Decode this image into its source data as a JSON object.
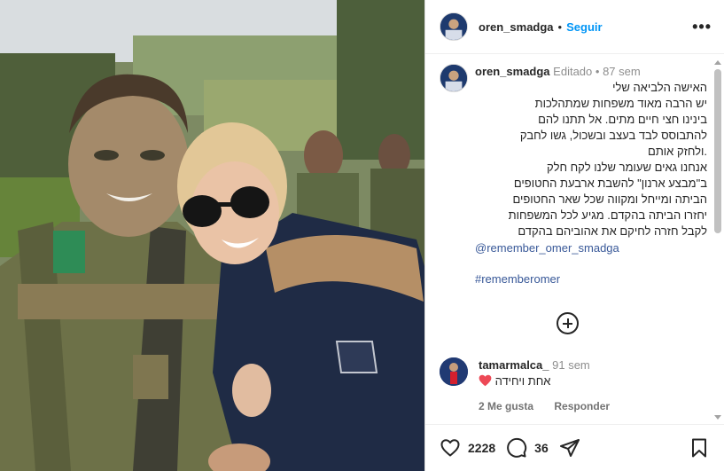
{
  "header": {
    "username": "oren_smadga",
    "separator": "•",
    "follow_label": "Seguir",
    "more_label": "•••"
  },
  "caption": {
    "username": "oren_smadga",
    "edited": "Editado",
    "separator": "•",
    "age": "87 sem",
    "lines": [
      "האישה הלביאה שלי",
      "יש הרבה מאוד משפחות שמתהלכות",
      "בינינו חצי חיים מתים. אל תתנו להם",
      "להתבוסס לבד בעצב ובשכול, גשו לחבק",
      ".ולחזק אותם",
      "אנחנו גאים שעומר שלנו לקח חלק",
      "ב\"מבצע ארנון\" להשבת ארבעת החטופים",
      "הביתה ומייחל ומקווה שכל שאר החטופים",
      "יחזרו הביתה בהקדם. מגיע לכל המשפחות",
      "לקבל חזרה לחיקם את אהוביהם בהקדם"
    ],
    "mention": "@remember_omer_smadga",
    "hashtag": "#rememberomer"
  },
  "comment": {
    "username": "tamarmalca_",
    "age": "91 sem",
    "text": "אחת ויחידה",
    "likes": "2 Me gusta",
    "reply": "Responder"
  },
  "actions": {
    "likes": "2228",
    "comments": "36"
  },
  "colors": {
    "link": "#385898",
    "follow": "#0095f6",
    "heart": "#ed4956"
  }
}
